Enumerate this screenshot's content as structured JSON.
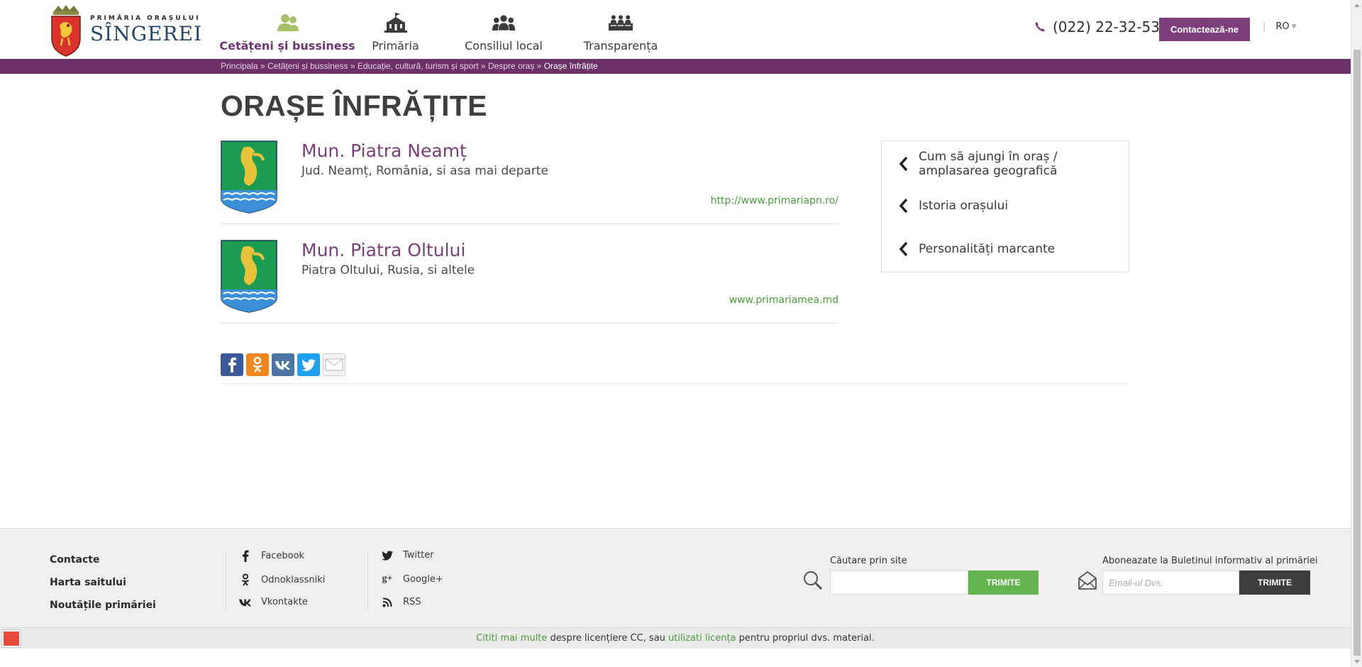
{
  "header": {
    "logo": {
      "small": "PRIMĂRIA ORAȘULUI",
      "big": "SÎNGEREI"
    },
    "nav": [
      {
        "label": "Cetățeni și bussiness",
        "icon": "citizens-icon",
        "active": true
      },
      {
        "label": "Primăria",
        "icon": "city-hall-icon",
        "active": false
      },
      {
        "label": "Consiliul local",
        "icon": "council-icon",
        "active": false
      },
      {
        "label": "Transparența",
        "icon": "transparency-icon",
        "active": false
      }
    ],
    "phone": "(022) 22-32-53",
    "contact_button": "Contactează-ne",
    "language": "RO"
  },
  "breadcrumb": {
    "items": [
      "Principala",
      "Cetățeni și bussiness",
      "Educație, cultură, turism și sport",
      "Despre oraș"
    ],
    "separator": "»",
    "current": "Orașe înfrățite"
  },
  "page_title": "ORAȘE ÎNFRĂȚITE",
  "cities": [
    {
      "name": "Mun. Piatra Neamț",
      "description": "Jud. Neamț, România, si asa mai departe",
      "link": "http://www.primariapn.ro/"
    },
    {
      "name": "Mun. Piatra Oltului",
      "description": "Piatra Oltului, Rusia, si altele",
      "link": "www.primariamea.md"
    }
  ],
  "share": [
    "facebook-share",
    "odnoklassniki-share",
    "vkontakte-share",
    "twitter-share",
    "email-share"
  ],
  "sidebar": [
    {
      "label": "Cum să ajungi în oraș / amplasarea geografică"
    },
    {
      "label": "Istoria orașului"
    },
    {
      "label": "Personalități marcante"
    }
  ],
  "footer": {
    "links": [
      "Contacte",
      "Harta saitului",
      "Noutățile primăriei"
    ],
    "social_col1": [
      "Facebook",
      "Odnoklassniki",
      "Vkontakte"
    ],
    "social_col2": [
      "Twitter",
      "Google+",
      "RSS"
    ],
    "search": {
      "label": "Căutare prin site",
      "placeholder": "",
      "button": "TRIMITE"
    },
    "newsletter": {
      "label": "Aboneazate la Buletinul informativ al primăriei",
      "placeholder": "Email-ul Dvs.",
      "button": "TRIMITE"
    }
  },
  "license": {
    "link1": "Cititi mai multe",
    "text1": " despre licențiere CC, sau ",
    "link2": "utilizati licența",
    "text2": " pentru propriul dvs. material."
  },
  "colors": {
    "brand_purple": "#6c3268",
    "accent_green": "#63b34e",
    "link_green": "#4a9c3c"
  }
}
